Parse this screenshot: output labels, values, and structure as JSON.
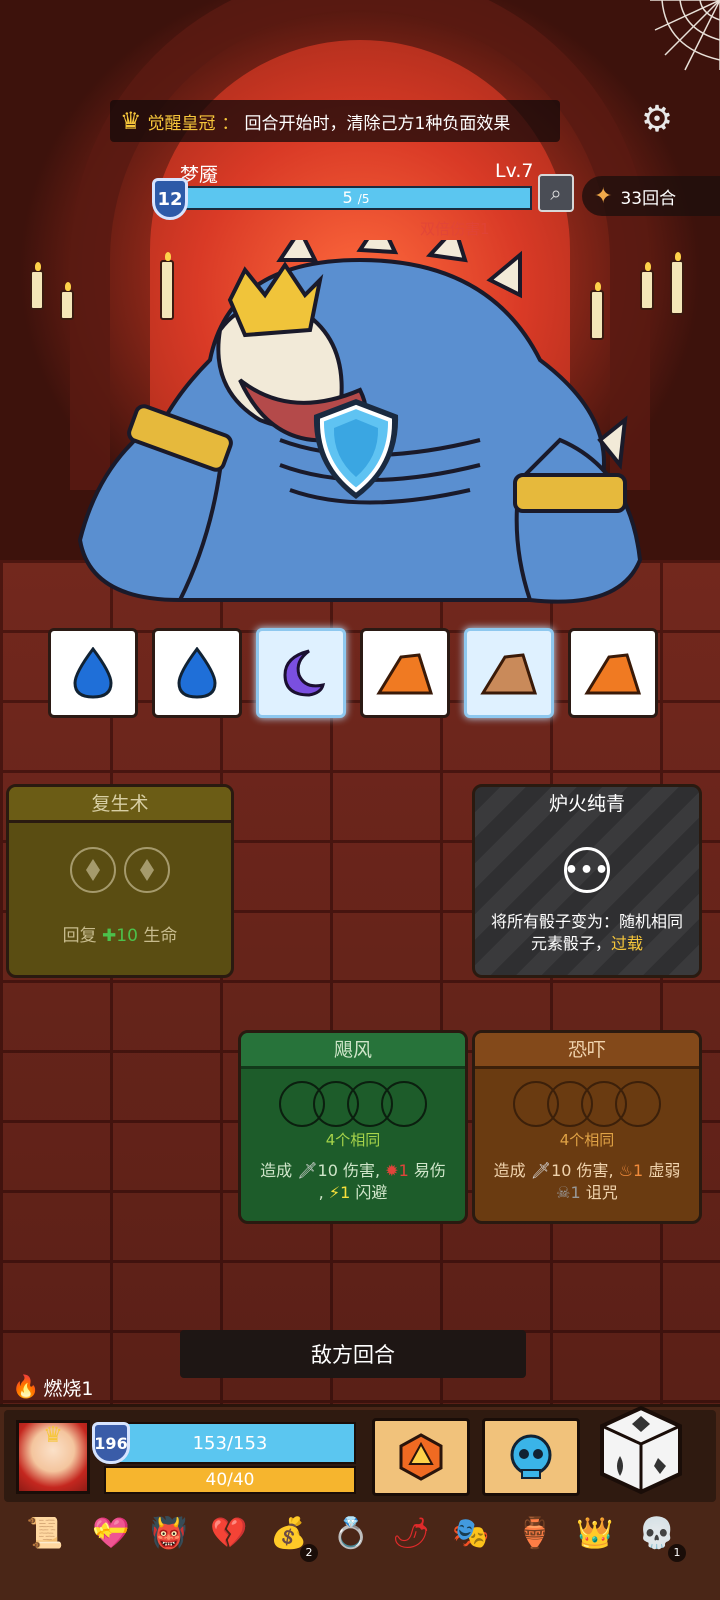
{
  "relic_banner": {
    "name": "觉醒皇冠",
    "separator": "：",
    "description": "回合开始时，清除己方1种负面效果"
  },
  "enemy": {
    "name": "梦魇",
    "level": "Lv.7",
    "shield": "12",
    "hp_current": "5",
    "hp_max": "/5",
    "hp_fraction": 1.0,
    "faded_status": "双倍伤害1"
  },
  "turn_counter": "33回合",
  "dice": [
    {
      "element": "water",
      "frozen": false
    },
    {
      "element": "water",
      "frozen": false
    },
    {
      "element": "moon",
      "frozen": true
    },
    {
      "element": "earth",
      "frozen": false
    },
    {
      "element": "earth",
      "frozen": true
    },
    {
      "element": "earth",
      "frozen": false
    }
  ],
  "cards": {
    "revive": {
      "title": "复生术",
      "desc_prefix": "回复",
      "heal_icon": "✚",
      "heal_value": "10",
      "desc_suffix": "生命"
    },
    "furnace": {
      "title": "炉火纯青",
      "desc": "将所有骰子变为：随机相同元素骰子，",
      "keyword": "过载"
    },
    "gale": {
      "title": "飓风",
      "match": "4个相同",
      "line1_prefix": "造成",
      "damage": "10",
      "line1_mid": "伤害,",
      "vuln": "1",
      "vuln_label": "易伤",
      "line2_prefix": ",",
      "dodge": "1",
      "dodge_label": "闪避"
    },
    "intimidate": {
      "title": "恐吓",
      "match": "4个相同",
      "line1_prefix": "造成",
      "damage": "10",
      "line1_mid": "伤害,",
      "weak": "1",
      "weak_label": "虚弱",
      "curse": "1",
      "curse_label": "诅咒"
    }
  },
  "enemy_turn_label": "敌方回合",
  "player_status": "燃烧1",
  "player": {
    "shield": "196",
    "hp": "153/153",
    "energy": "40/40"
  },
  "relics": [
    {
      "icon": "scroll-icon",
      "count": ""
    },
    {
      "icon": "heart-chest-icon",
      "count": ""
    },
    {
      "icon": "green-mask-icon",
      "count": ""
    },
    {
      "icon": "thorn-heart-icon",
      "count": ""
    },
    {
      "icon": "gold-pouch-icon",
      "count": "2"
    },
    {
      "icon": "red-ring-icon",
      "count": ""
    },
    {
      "icon": "chili-icon",
      "count": ""
    },
    {
      "icon": "red-lantern-icon",
      "count": ""
    },
    {
      "icon": "plague-mask-icon",
      "count": ""
    },
    {
      "icon": "teal-urn-icon",
      "count": ""
    },
    {
      "icon": "gold-crown-icon",
      "count": ""
    },
    {
      "icon": "flame-skull-icon",
      "count": "1"
    }
  ]
}
